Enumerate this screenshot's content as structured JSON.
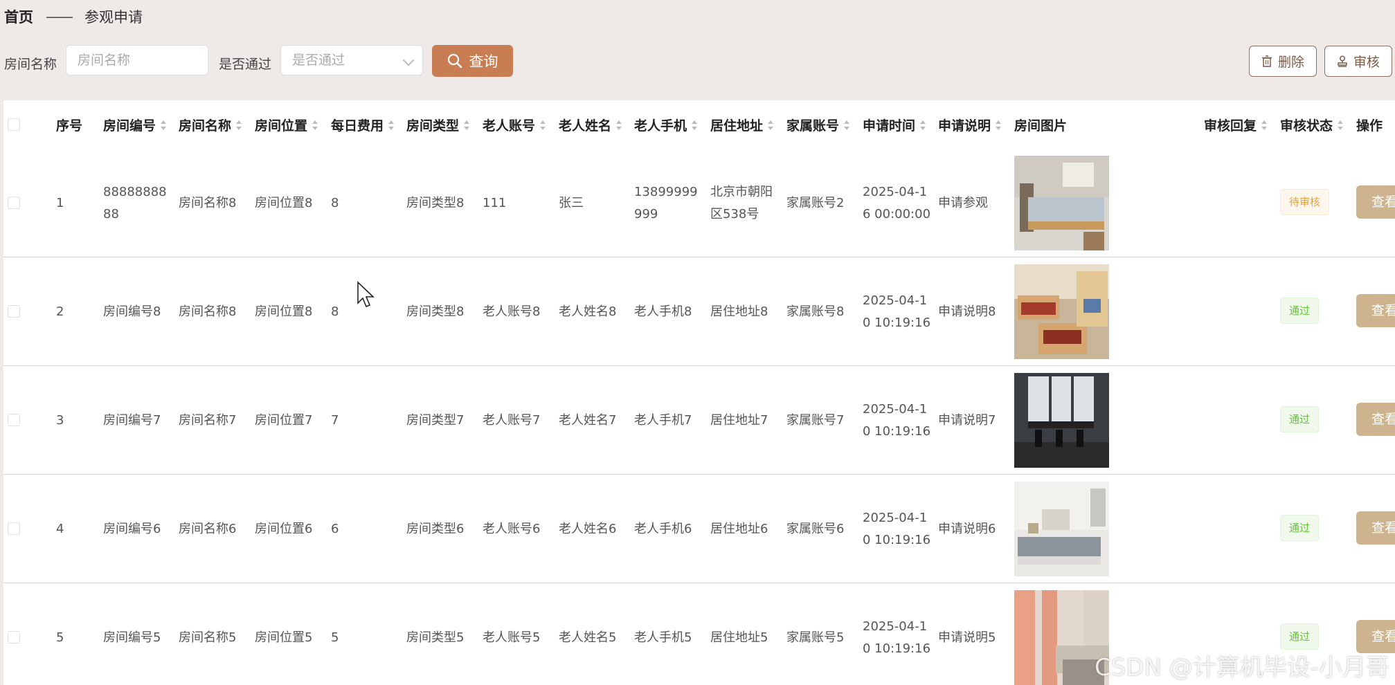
{
  "breadcrumb": {
    "home": "首页",
    "separator": "——",
    "current": "参观申请"
  },
  "filters": {
    "room_name_label": "房间名称",
    "room_name_placeholder": "房间名称",
    "passed_label": "是否通过",
    "passed_placeholder": "是否通过",
    "search_label": "查询"
  },
  "actions": {
    "delete_label": "删除",
    "review_label": "审核"
  },
  "table": {
    "headers": {
      "index": "序号",
      "room_no": "房间编号",
      "room_name": "房间名称",
      "room_location": "房间位置",
      "daily_fee": "每日费用",
      "room_type": "房间类型",
      "elder_account": "老人账号",
      "elder_name": "老人姓名",
      "elder_phone": "老人手机",
      "address": "居住地址",
      "family_account": "家属账号",
      "apply_time": "申请时间",
      "apply_desc": "申请说明",
      "room_image": "房间图片",
      "review_reply": "审核回复",
      "review_status": "审核状态",
      "operation": "操作"
    },
    "rows": [
      {
        "index": "1",
        "room_no": "8888888888",
        "room_name": "房间名称8",
        "room_location": "房间位置8",
        "daily_fee": "8",
        "room_type": "房间类型8",
        "elder_account": "111",
        "elder_name": "张三",
        "elder_phone": "13899999999",
        "address": "北京市朝阳区538号",
        "family_account": "家属账号2",
        "apply_time": "2025-04-16 00:00:00",
        "apply_desc": "申请参观",
        "review_reply": "",
        "status": "待审核",
        "status_type": "pending",
        "view_label": "查看"
      },
      {
        "index": "2",
        "room_no": "房间编号8",
        "room_name": "房间名称8",
        "room_location": "房间位置8",
        "daily_fee": "8",
        "room_type": "房间类型8",
        "elder_account": "老人账号8",
        "elder_name": "老人姓名8",
        "elder_phone": "老人手机8",
        "address": "居住地址8",
        "family_account": "家属账号8",
        "apply_time": "2025-04-10 10:19:16",
        "apply_desc": "申请说明8",
        "review_reply": "",
        "status": "通过",
        "status_type": "pass",
        "view_label": "查看"
      },
      {
        "index": "3",
        "room_no": "房间编号7",
        "room_name": "房间名称7",
        "room_location": "房间位置7",
        "daily_fee": "7",
        "room_type": "房间类型7",
        "elder_account": "老人账号7",
        "elder_name": "老人姓名7",
        "elder_phone": "老人手机7",
        "address": "居住地址7",
        "family_account": "家属账号7",
        "apply_time": "2025-04-10 10:19:16",
        "apply_desc": "申请说明7",
        "review_reply": "",
        "status": "通过",
        "status_type": "pass",
        "view_label": "查看"
      },
      {
        "index": "4",
        "room_no": "房间编号6",
        "room_name": "房间名称6",
        "room_location": "房间位置6",
        "daily_fee": "6",
        "room_type": "房间类型6",
        "elder_account": "老人账号6",
        "elder_name": "老人姓名6",
        "elder_phone": "老人手机6",
        "address": "居住地址6",
        "family_account": "家属账号6",
        "apply_time": "2025-04-10 10:19:16",
        "apply_desc": "申请说明6",
        "review_reply": "",
        "status": "通过",
        "status_type": "pass",
        "view_label": "查看"
      },
      {
        "index": "5",
        "room_no": "房间编号5",
        "room_name": "房间名称5",
        "room_location": "房间位置5",
        "daily_fee": "5",
        "room_type": "房间类型5",
        "elder_account": "老人账号5",
        "elder_name": "老人姓名5",
        "elder_phone": "老人手机5",
        "address": "居住地址5",
        "family_account": "家属账号5",
        "apply_time": "2025-04-10 10:19:16",
        "apply_desc": "申请说明5",
        "review_reply": "",
        "status": "通过",
        "status_type": "pass",
        "view_label": "查看"
      }
    ]
  },
  "watermark": "CSDN @计算机毕设-小月哥",
  "colors": {
    "background": "#efe9e7",
    "search_button": "#c97d52",
    "view_button": "#cdb38e",
    "status_pending": "#e6a23c",
    "status_pass": "#67c23a"
  }
}
